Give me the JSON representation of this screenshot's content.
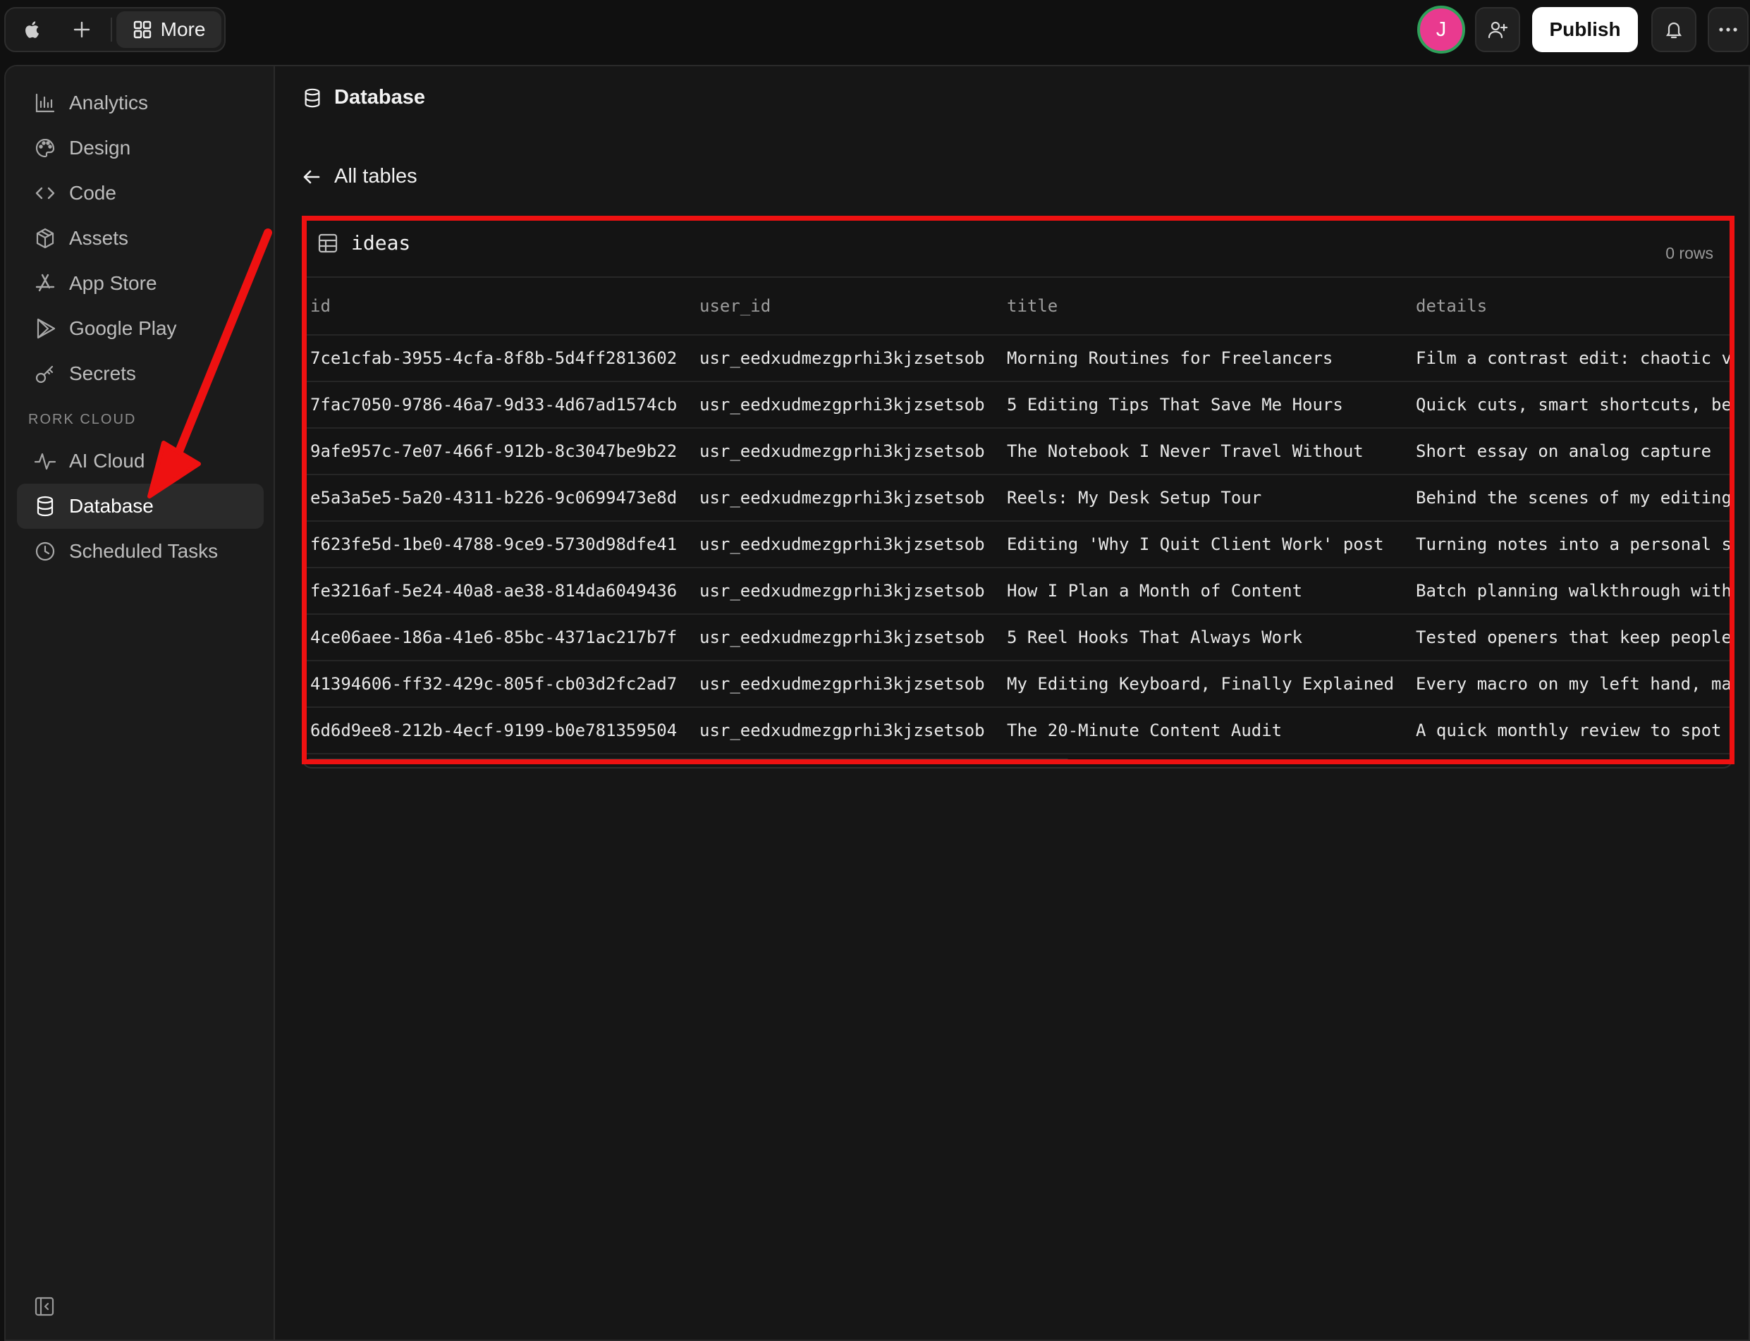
{
  "topbar": {
    "more_label": "More",
    "avatar_initial": "J",
    "publish_label": "Publish"
  },
  "sidebar": {
    "items": [
      {
        "label": "Analytics",
        "icon": "bar-chart-icon"
      },
      {
        "label": "Design",
        "icon": "palette-icon"
      },
      {
        "label": "Code",
        "icon": "code-icon"
      },
      {
        "label": "Assets",
        "icon": "box-icon"
      },
      {
        "label": "App Store",
        "icon": "app-store-icon"
      },
      {
        "label": "Google Play",
        "icon": "google-play-icon"
      },
      {
        "label": "Secrets",
        "icon": "key-icon"
      }
    ],
    "section_label": "RORK CLOUD",
    "cloud_items": [
      {
        "label": "AI Cloud",
        "icon": "pulse-icon"
      },
      {
        "label": "Database",
        "icon": "database-icon",
        "active": true
      },
      {
        "label": "Scheduled Tasks",
        "icon": "clock-icon"
      }
    ]
  },
  "page": {
    "title": "Database",
    "back_label": "All tables"
  },
  "table": {
    "name": "ideas",
    "row_count": "0 rows",
    "columns": [
      "id",
      "user_id",
      "title",
      "details"
    ],
    "rows": [
      [
        "7ce1cfab-3955-4cfa-8f8b-5d4ff2813602",
        "usr_eedxudmezgprhi3kjzsetsob",
        "Morning Routines for Freelancers",
        "Film a contrast edit: chaotic v"
      ],
      [
        "7fac7050-9786-46a7-9d33-4d67ad1574cb",
        "usr_eedxudmezgprhi3kjzsetsob",
        "5 Editing Tips That Save Me Hours",
        "Quick cuts, smart shortcuts, be"
      ],
      [
        "9afe957c-7e07-466f-912b-8c3047be9b22",
        "usr_eedxudmezgprhi3kjzsetsob",
        "The Notebook I Never Travel Without",
        "Short essay on analog capture"
      ],
      [
        "e5a3a5e5-5a20-4311-b226-9c0699473e8d",
        "usr_eedxudmezgprhi3kjzsetsob",
        "Reels: My Desk Setup Tour",
        "Behind the scenes of my editing"
      ],
      [
        "f623fe5d-1be0-4788-9ce9-5730d98dfe41",
        "usr_eedxudmezgprhi3kjzsetsob",
        "Editing 'Why I Quit Client Work' post",
        "Turning notes into a personal s"
      ],
      [
        "fe3216af-5e24-40a8-ae38-814da6049436",
        "usr_eedxudmezgprhi3kjzsetsob",
        "How I Plan a Month of Content",
        "Batch planning walkthrough with"
      ],
      [
        "4ce06aee-186a-41e6-85bc-4371ac217b7f",
        "usr_eedxudmezgprhi3kjzsetsob",
        "5 Reel Hooks That Always Work",
        "Tested openers that keep people"
      ],
      [
        "41394606-ff32-429c-805f-cb03d2fc2ad7",
        "usr_eedxudmezgprhi3kjzsetsob",
        "My Editing Keyboard, Finally Explained",
        "Every macro on my left hand, ma"
      ],
      [
        "6d6d9ee8-212b-4ecf-9199-b0e781359504",
        "usr_eedxudmezgprhi3kjzsetsob",
        "The 20-Minute Content Audit",
        "A quick monthly review to spot"
      ]
    ]
  },
  "colors": {
    "annotation": "#ee1111",
    "avatar": "#e93a8f",
    "avatar_ring": "#2ea15a"
  }
}
